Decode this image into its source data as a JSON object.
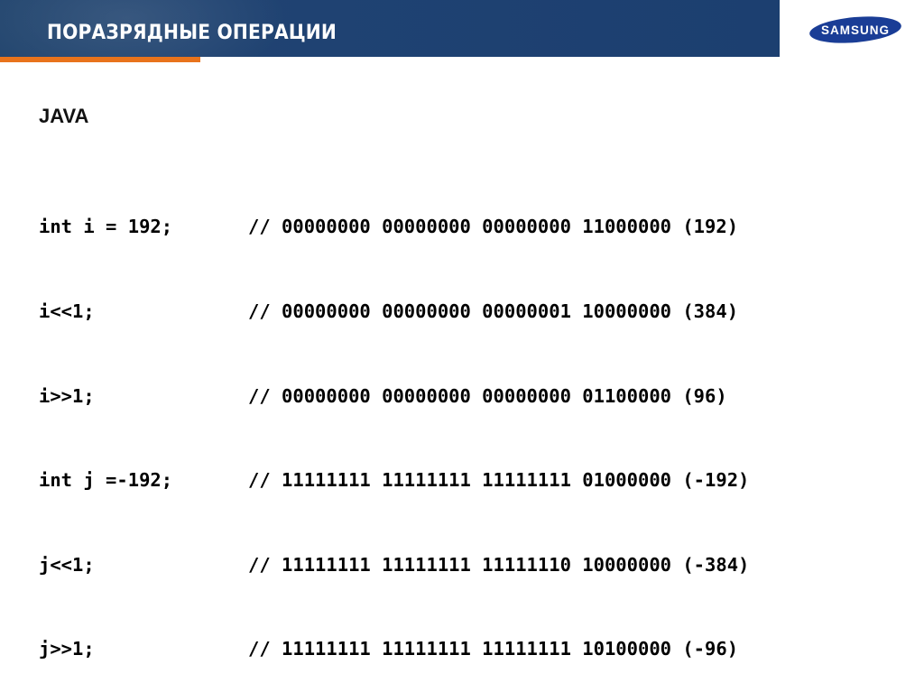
{
  "header": {
    "title": "ПОРАЗРЯДНЫЕ ОПЕРАЦИИ",
    "brand": "SAMSUNG",
    "colors": {
      "band": "#1f4272",
      "accent": "#e8731c",
      "logo": "#1a3d96"
    }
  },
  "content": {
    "heading": "JAVA",
    "lines": [
      {
        "statement": "int i = 192;",
        "comment": "// 00000000 00000000 00000000 11000000 (192)"
      },
      {
        "statement": "i<<1;",
        "comment": "// 00000000 00000000 00000001 10000000 (384)"
      },
      {
        "statement": "i>>1;",
        "comment": "// 00000000 00000000 00000000 01100000 (96)"
      },
      {
        "statement": "int j =-192;",
        "comment": "// 11111111 11111111 11111111 01000000 (-192)"
      },
      {
        "statement": "j<<1;",
        "comment": "// 11111111 11111111 11111110 10000000 (-384)"
      },
      {
        "statement": "j>>1;",
        "comment": "// 11111111 11111111 11111111 10100000 (-96)"
      }
    ]
  }
}
